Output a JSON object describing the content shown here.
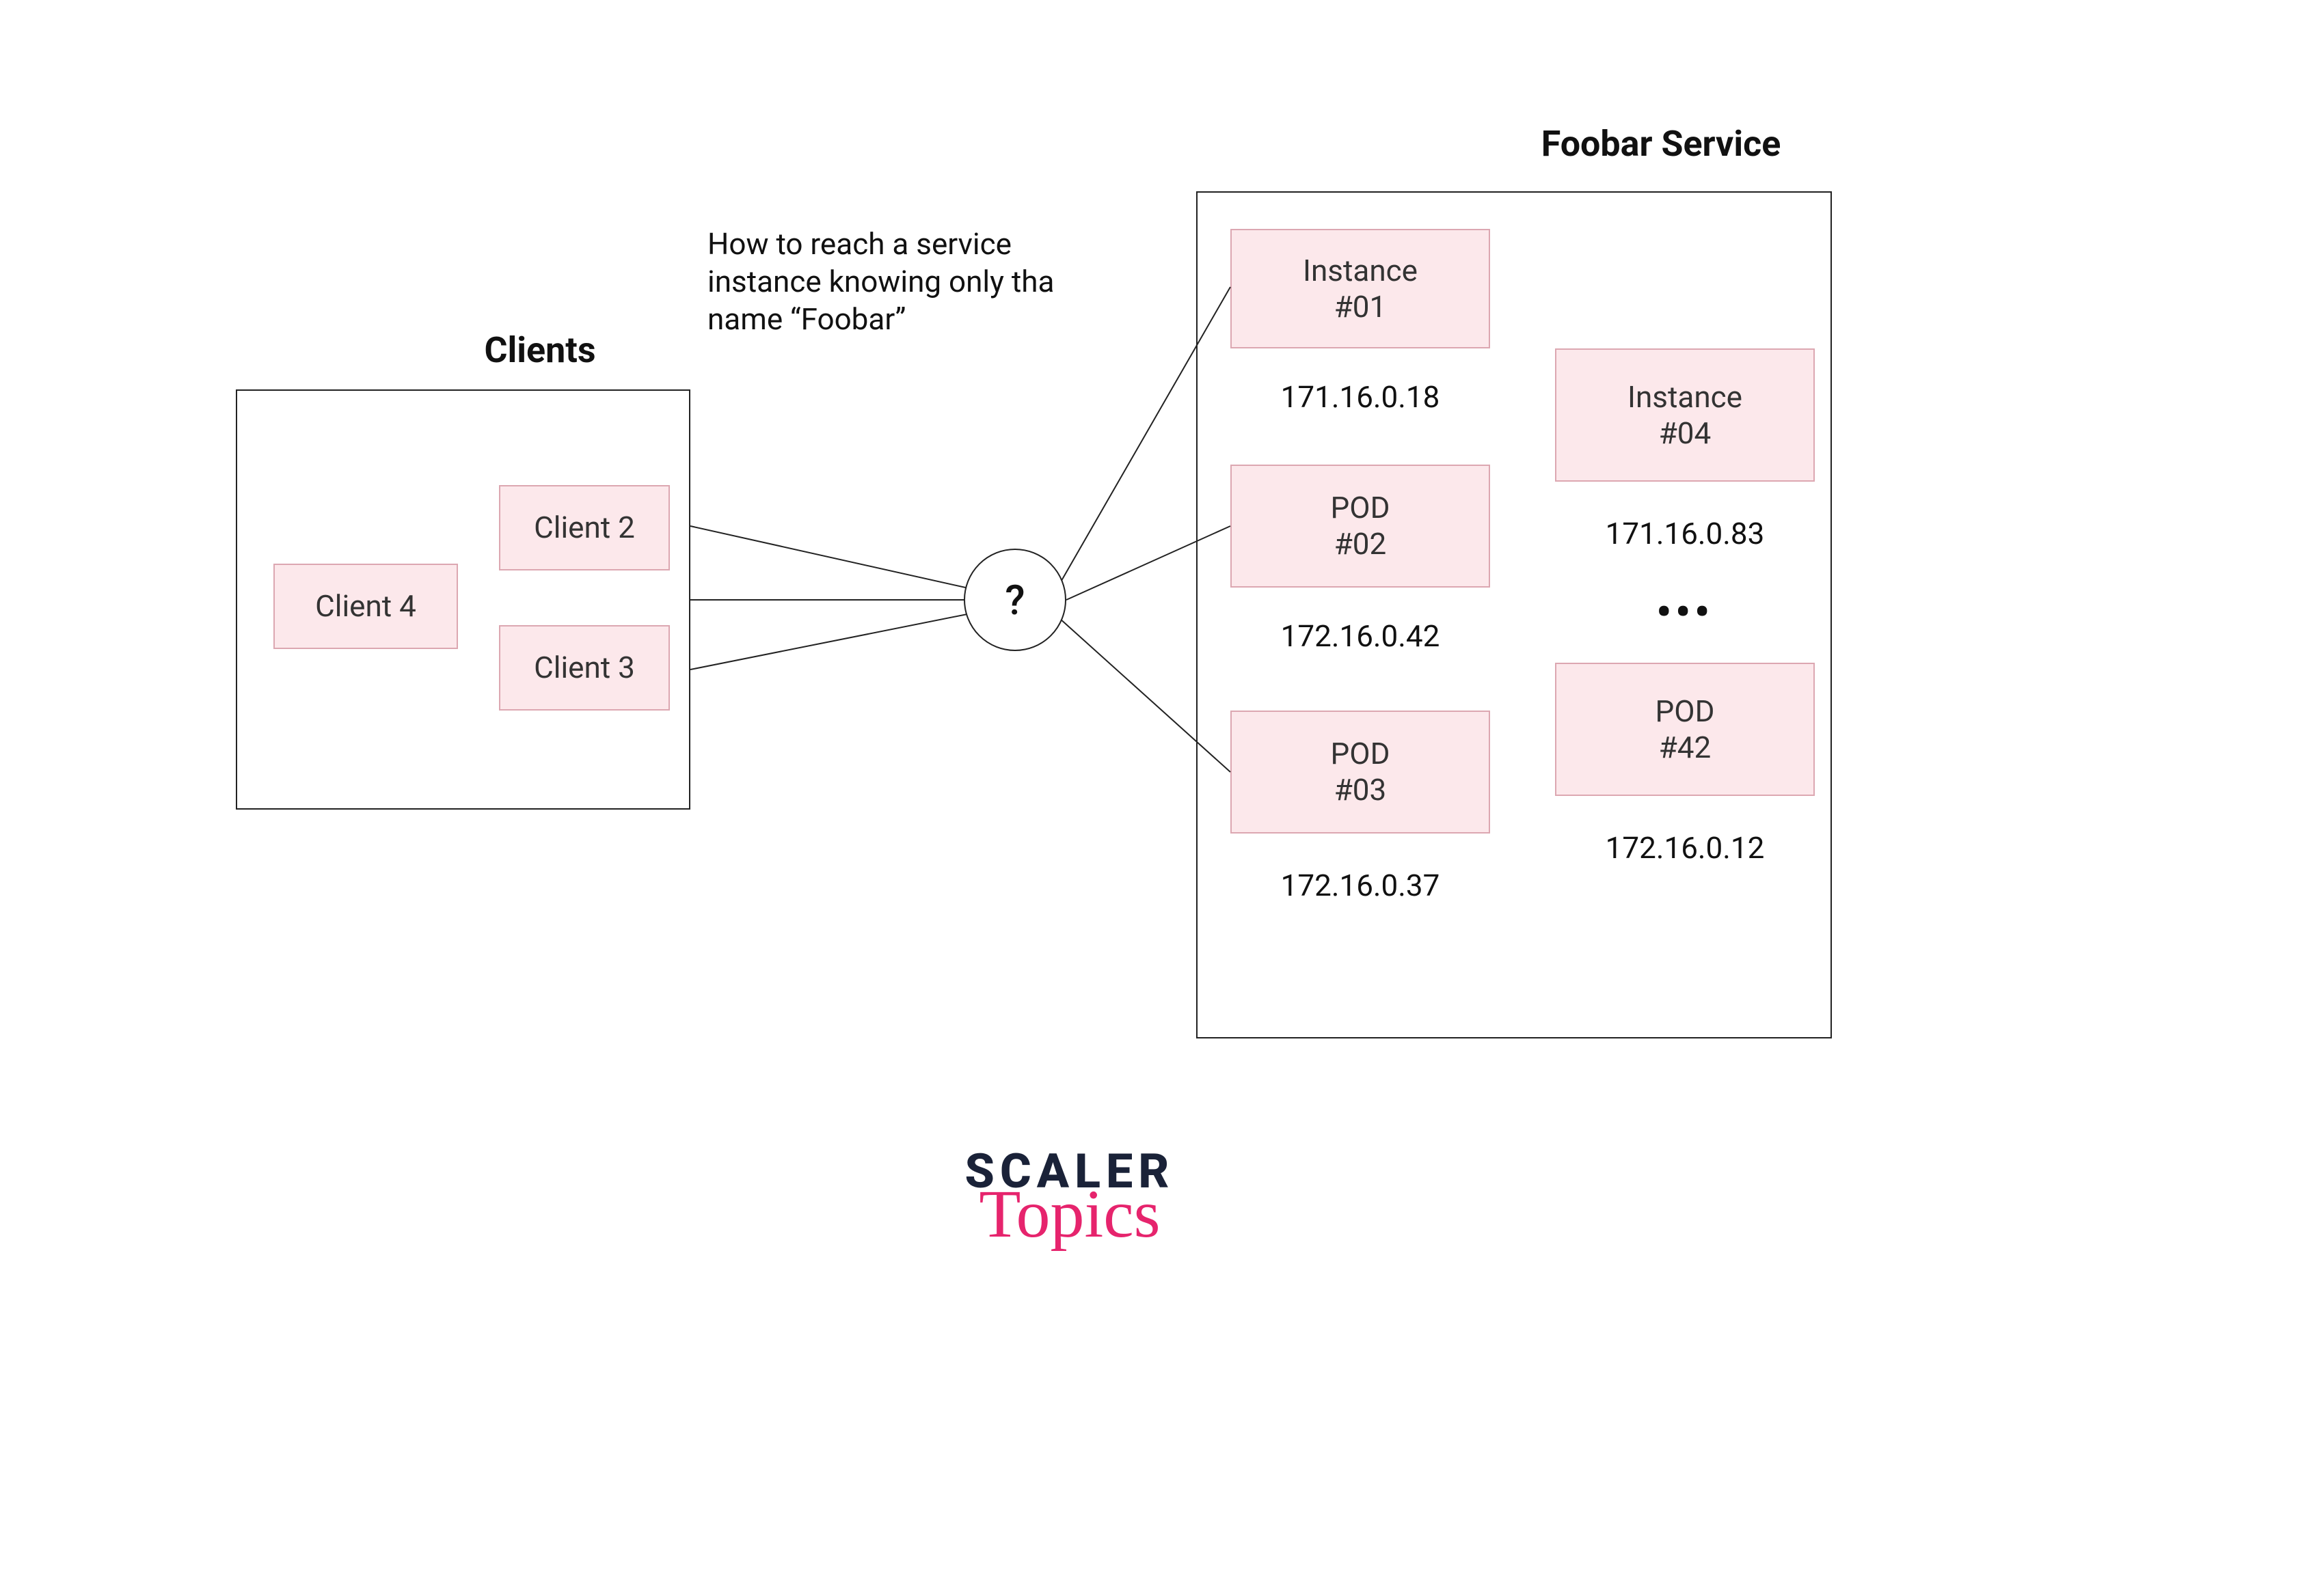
{
  "clients_title": "Clients",
  "service_title": "Foobar Service",
  "clients": {
    "c4": "Client 4",
    "c2": "Client 2",
    "c3": "Client 3"
  },
  "note": "How to reach a service instance knowing only tha name “Foobar”",
  "question_mark": "?",
  "instances": {
    "inst01": "Instance\n#01",
    "inst01_ip": "171.16.0.18",
    "pod02": "POD\n#02",
    "pod02_ip": "172.16.0.42",
    "pod03": "POD\n#03",
    "pod03_ip": "172.16.0.37",
    "inst04": "Instance\n#04",
    "inst04_ip": "171.16.0.83",
    "dots": "•••",
    "pod42": "POD\n#42",
    "pod42_ip": "172.16.0.12"
  },
  "logo": {
    "top": "SCALER",
    "bottom": "Topics"
  }
}
